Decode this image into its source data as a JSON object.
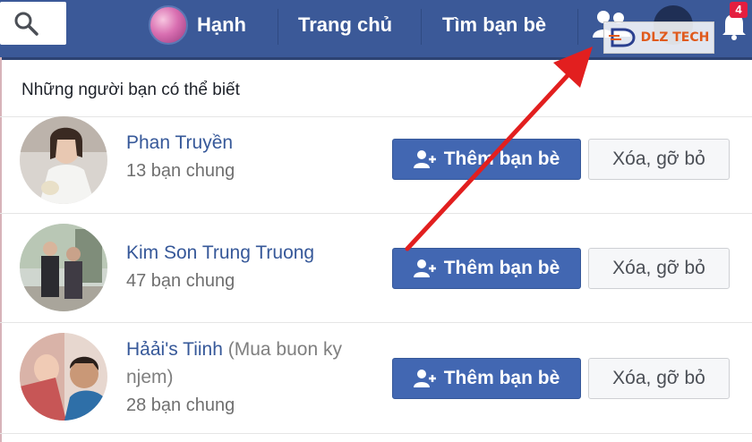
{
  "topbar": {
    "user_name": "Hạnh",
    "home_label": "Trang chủ",
    "find_friends_label": "Tìm bạn bè",
    "notification_count": "4",
    "icons": [
      "search-icon",
      "friends-icon",
      "messenger-icon",
      "bell-icon"
    ]
  },
  "watermark": {
    "text": "DLZ TECH"
  },
  "panel": {
    "title": "Những người bạn có thể biết"
  },
  "suggestions": [
    {
      "name": "Phan Truyền",
      "note": "",
      "mutual": "13 bạn chung",
      "add_label": "Thêm bạn bè",
      "remove_label": "Xóa, gỡ bỏ"
    },
    {
      "name": "Kim Son Trung Truong",
      "note": "",
      "mutual": "47 bạn chung",
      "add_label": "Thêm bạn bè",
      "remove_label": "Xóa, gỡ bỏ"
    },
    {
      "name": "Hảải's Tiinh",
      "note": "(Mua buon ky",
      "note2": "njem)",
      "mutual": "28 bạn chung",
      "add_label": "Thêm bạn bè",
      "remove_label": "Xóa, gỡ bỏ"
    }
  ],
  "colors": {
    "topbar": "#3b5998",
    "primary_button": "#4267b2",
    "link": "#365899",
    "arrow": "#e21f1f",
    "watermark": "#e05a1c"
  }
}
